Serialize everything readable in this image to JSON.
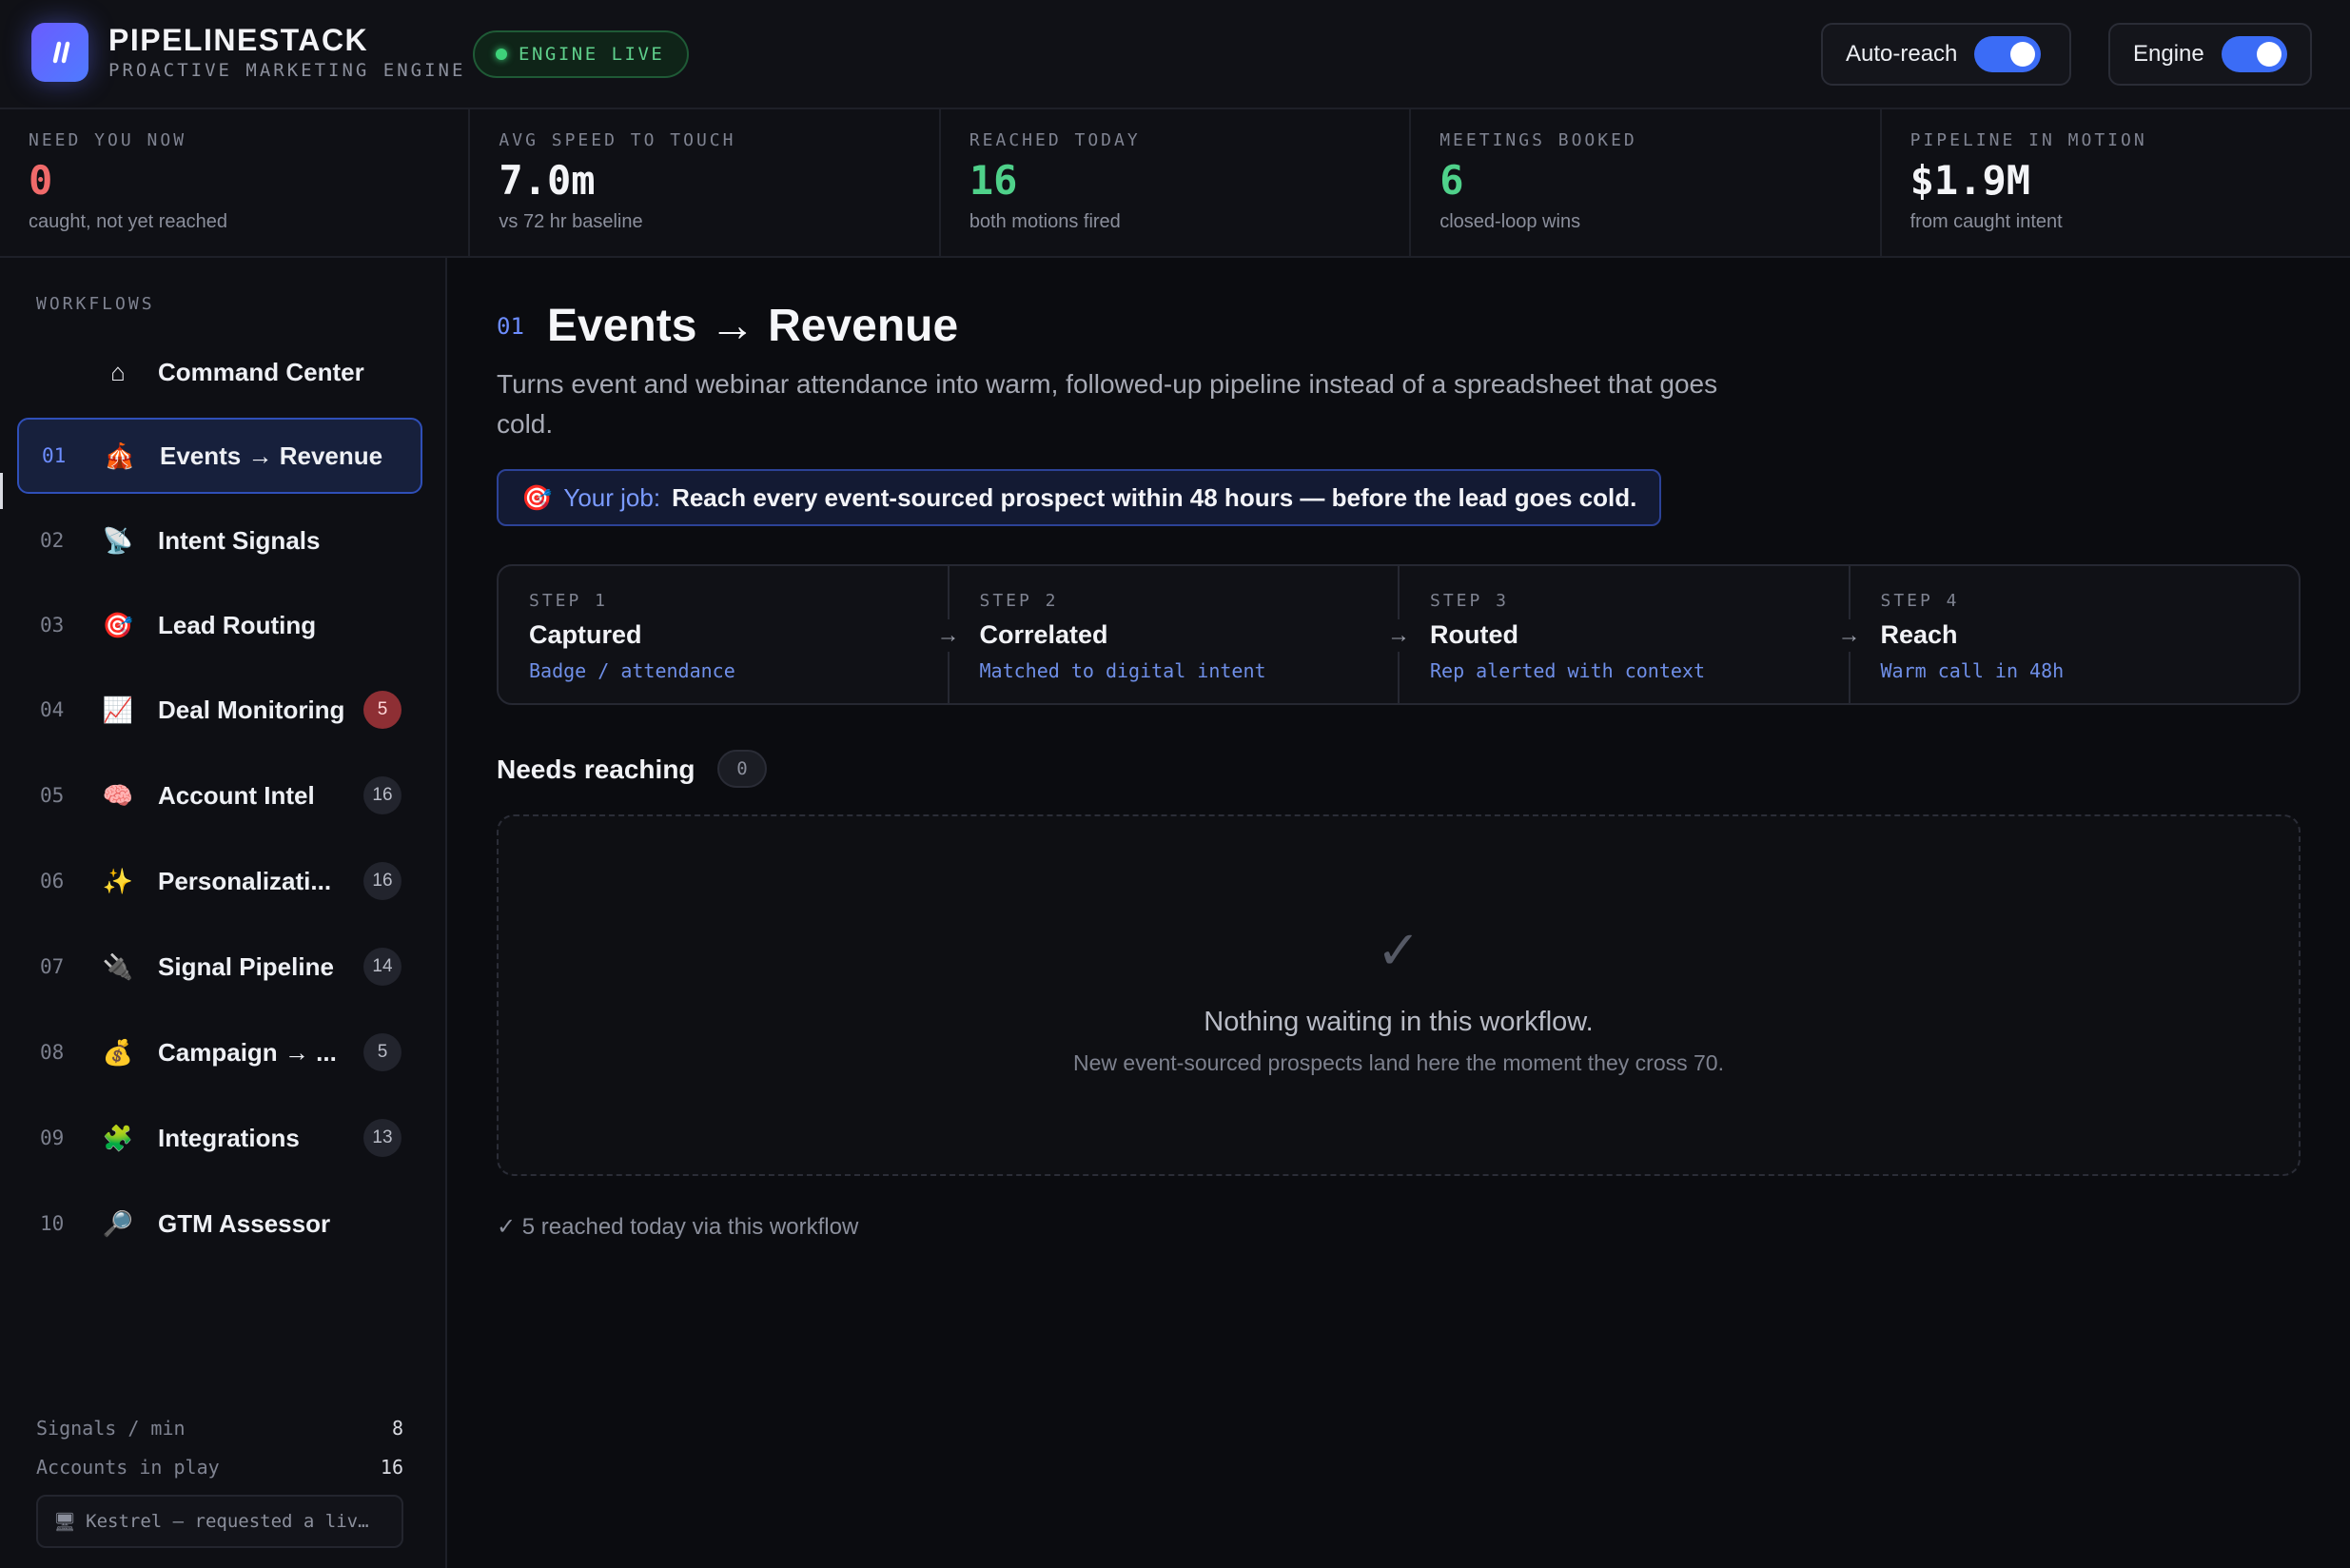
{
  "app": {
    "brand": "PIPELINESTACK",
    "tagline": "PROACTIVE MARKETING ENGINE",
    "status": "ENGINE LIVE",
    "toggles": [
      {
        "label": "Auto-reach",
        "on": true
      },
      {
        "label": "Engine",
        "on": true
      }
    ]
  },
  "kpis": [
    {
      "label": "NEED YOU NOW",
      "value": "0",
      "sub": "caught, not yet reached",
      "color": "#f06a6a"
    },
    {
      "label": "AVG SPEED TO TOUCH",
      "value": "7.0m",
      "sub": "vs 72 hr baseline",
      "color": "#f3f4f7"
    },
    {
      "label": "REACHED TODAY",
      "value": "16",
      "sub": "both motions fired",
      "color": "#4fd18a"
    },
    {
      "label": "MEETINGS BOOKED",
      "value": "6",
      "sub": "closed-loop wins",
      "color": "#4fd18a"
    },
    {
      "label": "PIPELINE IN MOTION",
      "value": "$1.9M",
      "sub": "from caught intent",
      "color": "#f3f4f7"
    }
  ],
  "sidebar": {
    "heading": "WORKFLOWS",
    "items": [
      {
        "num": "",
        "icon": "⌂",
        "icon_name": "home-icon",
        "label": "Command Center",
        "badge": ""
      },
      {
        "num": "01",
        "icon": "🎪",
        "icon_name": "circus-tent-icon",
        "label": "Events → Revenue",
        "badge": "",
        "active": true
      },
      {
        "num": "02",
        "icon": "📡",
        "icon_name": "satellite-dish-icon",
        "label": "Intent Signals",
        "badge": ""
      },
      {
        "num": "03",
        "icon": "🎯",
        "icon_name": "target-icon",
        "label": "Lead Routing",
        "badge": ""
      },
      {
        "num": "04",
        "icon": "📈",
        "icon_name": "chart-up-icon",
        "label": "Deal Monitoring",
        "badge": "5",
        "alert": true
      },
      {
        "num": "05",
        "icon": "🧠",
        "icon_name": "brain-icon",
        "label": "Account Intel",
        "badge": "16"
      },
      {
        "num": "06",
        "icon": "✨",
        "icon_name": "sparkles-icon",
        "label": "Personalizati...",
        "badge": "16"
      },
      {
        "num": "07",
        "icon": "🔌",
        "icon_name": "plug-icon",
        "label": "Signal Pipeline",
        "badge": "14"
      },
      {
        "num": "08",
        "icon": "💰",
        "icon_name": "money-bag-icon",
        "label": "Campaign → ...",
        "badge": "5"
      },
      {
        "num": "09",
        "icon": "🧩",
        "icon_name": "puzzle-icon",
        "label": "Integrations",
        "badge": "13"
      },
      {
        "num": "10",
        "icon": "🔎",
        "icon_name": "magnifier-icon",
        "label": "GTM Assessor",
        "badge": ""
      }
    ],
    "stats": [
      {
        "label": "Signals / min",
        "value": "8"
      },
      {
        "label": "Accounts in play",
        "value": "16"
      }
    ],
    "ticker": "Kestrel — requested a liv…"
  },
  "main": {
    "num": "01",
    "title": "Events → Revenue",
    "description": "Turns event and webinar attendance into warm, followed-up pipeline instead of a spreadsheet that goes cold.",
    "job_label": "Your job:",
    "job_text": "Reach every event-sourced prospect within 48 hours — before the lead goes cold.",
    "steps": [
      {
        "kicker": "STEP 1",
        "title": "Captured",
        "sub": "Badge / attendance"
      },
      {
        "kicker": "STEP 2",
        "title": "Correlated",
        "sub": "Matched to digital intent"
      },
      {
        "kicker": "STEP 3",
        "title": "Routed",
        "sub": "Rep alerted with context"
      },
      {
        "kicker": "STEP 4",
        "title": "Reach",
        "sub": "Warm call in 48h"
      }
    ],
    "needs_title": "Needs reaching",
    "needs_count": "0",
    "empty_title": "Nothing waiting in this workflow.",
    "empty_sub": "New event-sourced prospects land here the moment they cross 70.",
    "reached_footer": "✓ 5 reached today via this workflow"
  }
}
